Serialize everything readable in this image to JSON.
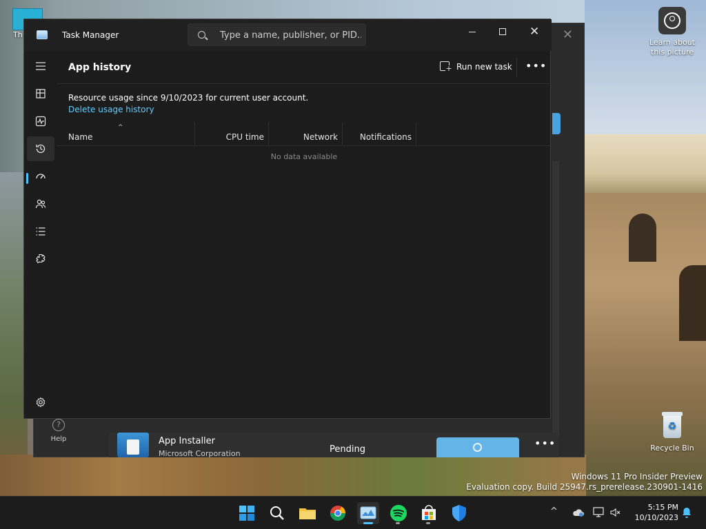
{
  "desktop": {
    "icon_partial_label": "Th",
    "learn_label_line1": "Learn about",
    "learn_label_line2": "this picture",
    "recycle_label": "Recycle Bin",
    "watermark_line1": "Windows 11 Pro Insider Preview",
    "watermark_line2": "Evaluation copy. Build 25947.rs_prerelease.230901-1416"
  },
  "back_window": {
    "help_label": "Help",
    "help_glyph": "?",
    "close_glyph": "✕",
    "installer": {
      "name": "App Installer",
      "publisher": "Microsoft Corporation",
      "status": "Pending",
      "more_glyph": "•••"
    }
  },
  "task_manager": {
    "title": "Task Manager",
    "search_placeholder": "Type a name, publisher, or PID...",
    "close_glyph": "✕",
    "page_title": "App history",
    "run_new_task_label": "Run new task",
    "run_new_task_plus": "+",
    "more_glyph": "•••",
    "resource_text": "Resource usage since 9/10/2023 for current user account.",
    "delete_link": "Delete usage history",
    "sort_caret": "^",
    "columns": [
      "Name",
      "CPU time",
      "Network",
      "Notifications"
    ],
    "empty_text": "No data available",
    "nav_items": [
      {
        "name": "hamburger-menu-icon"
      },
      {
        "name": "processes-icon"
      },
      {
        "name": "performance-icon"
      },
      {
        "name": "app-history-icon"
      },
      {
        "name": "startup-apps-icon"
      },
      {
        "name": "users-icon"
      },
      {
        "name": "details-icon"
      },
      {
        "name": "services-icon"
      },
      {
        "name": "settings-icon"
      }
    ],
    "active_nav": "app-history-icon"
  },
  "taskbar": {
    "time": "5:15 PM",
    "date": "10/10/2023",
    "tray_chevron": "^",
    "accent": "#4cc2ff"
  }
}
